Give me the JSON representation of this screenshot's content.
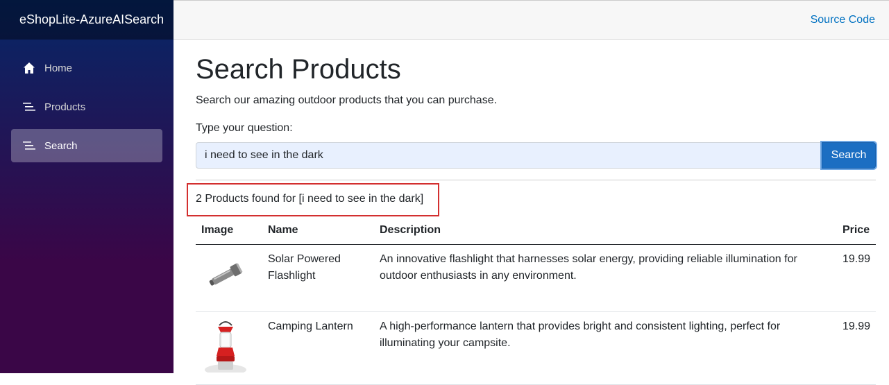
{
  "app": {
    "brand": "eShopLite-AzureAISearch"
  },
  "nav": {
    "items": [
      {
        "label": "Home",
        "icon": "home-icon"
      },
      {
        "label": "Products",
        "icon": "list-icon"
      },
      {
        "label": "Search",
        "icon": "list-icon",
        "active": true
      }
    ]
  },
  "topbar": {
    "source_code": "Source Code"
  },
  "page": {
    "title": "Search Products",
    "subtitle": "Search our amazing outdoor products that you can purchase.",
    "question_label": "Type your question:",
    "search_value": "i need to see in the dark",
    "search_button": "Search",
    "results_text": "2 Products found for [i need to see in the dark]"
  },
  "table": {
    "headers": [
      "Image",
      "Name",
      "Description",
      "Price"
    ],
    "rows": [
      {
        "image": "flashlight",
        "name": "Solar Powered Flashlight",
        "description": "An innovative flashlight that harnesses solar energy, providing reliable illumination for outdoor enthusiasts in any environment.",
        "price": "19.99"
      },
      {
        "image": "lantern",
        "name": "Camping Lantern",
        "description": "A high-performance lantern that provides bright and consistent lighting, perfect for illuminating your campsite.",
        "price": "19.99"
      }
    ]
  },
  "colors": {
    "accent": "#1b6ec2",
    "highlight": "#d32f2f",
    "link": "#0071c1"
  }
}
